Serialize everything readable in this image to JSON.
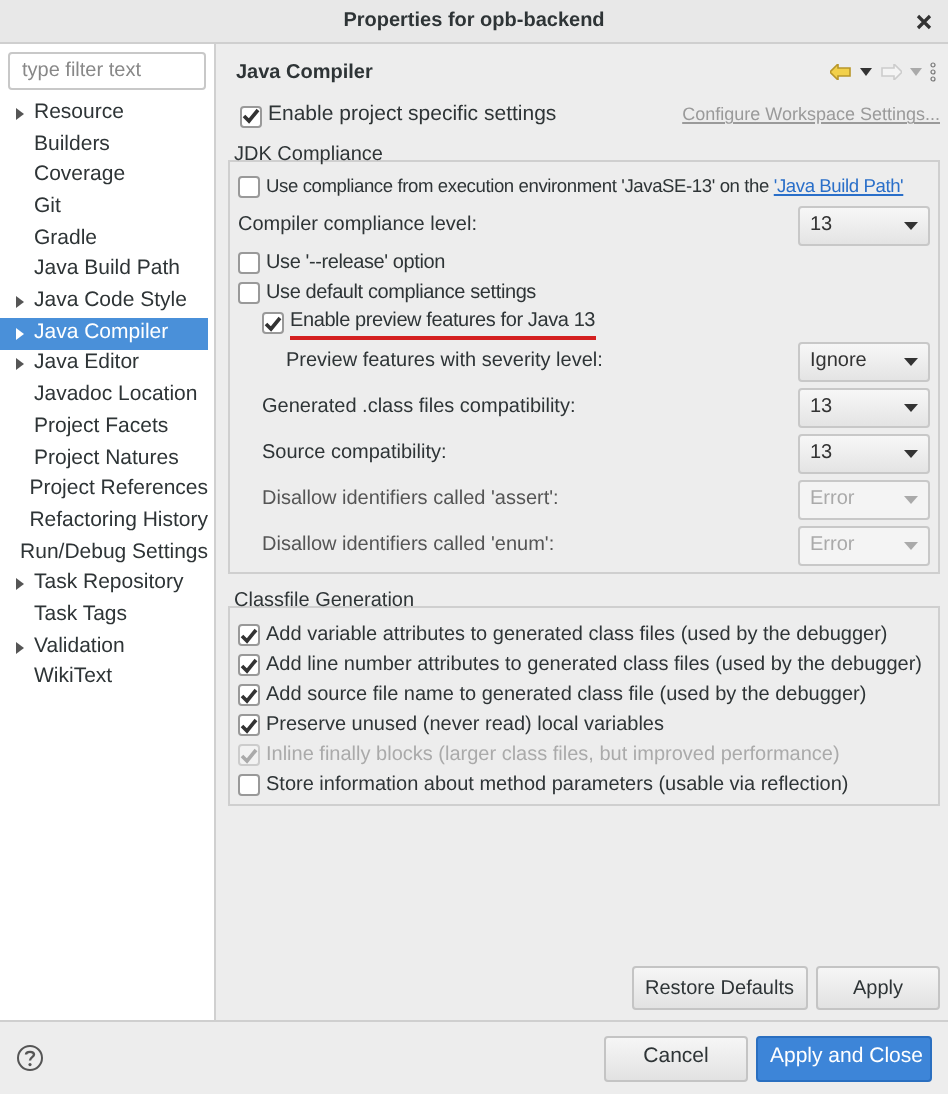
{
  "window": {
    "title": "Properties for opb-backend"
  },
  "filter": {
    "placeholder": "type filter text"
  },
  "tree": [
    {
      "label": "Resource",
      "expandable": true,
      "selected": false
    },
    {
      "label": "Builders",
      "expandable": false,
      "selected": false
    },
    {
      "label": "Coverage",
      "expandable": false,
      "selected": false
    },
    {
      "label": "Git",
      "expandable": false,
      "selected": false
    },
    {
      "label": "Gradle",
      "expandable": false,
      "selected": false
    },
    {
      "label": "Java Build Path",
      "expandable": false,
      "selected": false
    },
    {
      "label": "Java Code Style",
      "expandable": true,
      "selected": false
    },
    {
      "label": "Java Compiler",
      "expandable": true,
      "selected": true
    },
    {
      "label": "Java Editor",
      "expandable": true,
      "selected": false
    },
    {
      "label": "Javadoc Location",
      "expandable": false,
      "selected": false
    },
    {
      "label": "Project Facets",
      "expandable": false,
      "selected": false
    },
    {
      "label": "Project Natures",
      "expandable": false,
      "selected": false
    },
    {
      "label": "Project References",
      "expandable": false,
      "selected": false
    },
    {
      "label": "Refactoring History",
      "expandable": false,
      "selected": false
    },
    {
      "label": "Run/Debug Settings",
      "expandable": false,
      "selected": false
    },
    {
      "label": "Task Repository",
      "expandable": true,
      "selected": false
    },
    {
      "label": "Task Tags",
      "expandable": false,
      "selected": false
    },
    {
      "label": "Validation",
      "expandable": true,
      "selected": false
    },
    {
      "label": "WikiText",
      "expandable": false,
      "selected": false
    }
  ],
  "page": {
    "title": "Java Compiler",
    "project_specific": {
      "label": "Enable project specific settings",
      "checked": true
    },
    "configure_link": "Configure Workspace Settings...",
    "jdk_compliance": {
      "title": "JDK Compliance",
      "rows": [
        {
          "kind": "checkbox",
          "label": "Use compliance from execution environment 'JavaSE-13' on the ",
          "link": "'Java Build Path'",
          "checked": false,
          "disabled": false,
          "highlighted": false
        },
        {
          "kind": "combo",
          "label": "Compiler compliance level:",
          "value": "13",
          "disabled": false
        },
        {
          "kind": "checkbox",
          "label": "Use '--release' option",
          "checked": false,
          "disabled": false,
          "highlighted": false
        },
        {
          "kind": "checkbox",
          "label": "Use default compliance settings",
          "checked": false,
          "disabled": false,
          "highlighted": false,
          "children": [
            {
              "kind": "checkbox",
              "label": "Enable preview features for Java 13",
              "checked": true,
              "disabled": false,
              "highlighted": true,
              "children": [
                {
                  "kind": "combo",
                  "label": "Preview features with severity level:",
                  "value": "Ignore",
                  "disabled": false
                }
              ]
            },
            {
              "kind": "combo",
              "label": "Generated .class files compatibility:",
              "value": "13",
              "disabled": false
            },
            {
              "kind": "combo",
              "label": "Source compatibility:",
              "value": "13",
              "disabled": false
            },
            {
              "kind": "combo",
              "label": "Disallow identifiers called 'assert':",
              "value": "Error",
              "disabled": true
            },
            {
              "kind": "combo",
              "label": "Disallow identifiers called 'enum':",
              "value": "Error",
              "disabled": true
            }
          ]
        }
      ]
    },
    "classfile_generation": {
      "title": "Classfile Generation",
      "options": [
        {
          "label": "Add variable attributes to generated class files (used by the debugger)",
          "checked": true,
          "disabled": false
        },
        {
          "label": "Add line number attributes to generated class files (used by the debugger)",
          "checked": true,
          "disabled": false
        },
        {
          "label": "Add source file name to generated class file (used by the debugger)",
          "checked": true,
          "disabled": false
        },
        {
          "label": "Preserve unused (never read) local variables",
          "checked": true,
          "disabled": false
        },
        {
          "label": "Inline finally blocks (larger class files, but improved performance)",
          "checked": true,
          "disabled": true
        },
        {
          "label": "Store information about method parameters (usable via reflection)",
          "checked": false,
          "disabled": false
        }
      ]
    },
    "buttons": [
      "Restore Defaults",
      "Apply"
    ]
  },
  "footer": {
    "buttons": [
      {
        "label": "Cancel",
        "primary": false
      },
      {
        "label": "Apply and Close",
        "primary": true
      }
    ]
  }
}
